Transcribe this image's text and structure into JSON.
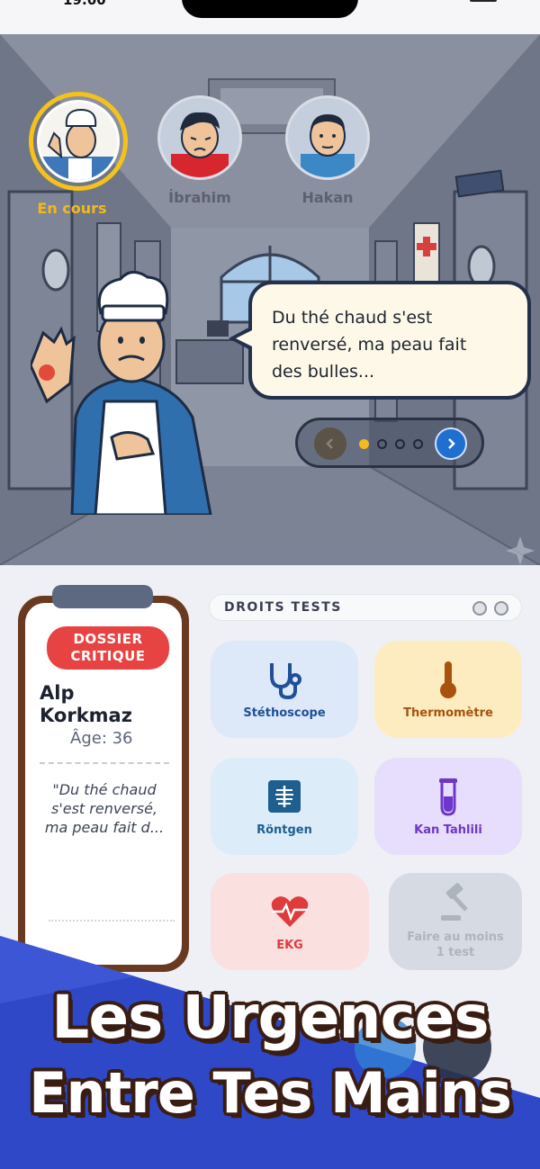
{
  "status": {
    "time": "19:00"
  },
  "patients": [
    {
      "label": "En cours",
      "active": true,
      "icon": "chef-patient-avatar"
    },
    {
      "label": "İbrahim",
      "active": false,
      "icon": "crying-boy-avatar"
    },
    {
      "label": "Hakan",
      "active": false,
      "icon": "boy-hoodie-avatar"
    }
  ],
  "dialogue": {
    "line1": "Du thé chaud s'est",
    "line2": "renversé, ma peau fait",
    "line3": "des bulles...",
    "pages_total": 4,
    "page_current": 1
  },
  "dossier": {
    "badge_line1": "DOSSIER",
    "badge_line2": "CRITIQUE",
    "first_name": "Alp",
    "last_name": "Korkmaz",
    "age": "Âge: 36",
    "quote_l1": "\"Du thé chaud",
    "quote_l2": "s'est renversé,",
    "quote_l3": "ma peau fait d..."
  },
  "tests": {
    "header": "DROITS TESTS",
    "items": [
      {
        "label": "Stéthoscope",
        "icon": "stethoscope-icon",
        "bg": "#dde8f8",
        "color": "#1f4f98"
      },
      {
        "label": "Thermomètre",
        "icon": "thermometer-icon",
        "bg": "#fdecc0",
        "color": "#a8520d"
      },
      {
        "label": "Röntgen",
        "icon": "xray-icon",
        "bg": "#dcecf8",
        "color": "#1f5f8f"
      },
      {
        "label": "Kan Tahlili",
        "icon": "blood-tube-icon",
        "bg": "#e7ddfc",
        "color": "#6d37c9"
      },
      {
        "label": "EKG",
        "icon": "heart-pulse-icon",
        "bg": "#fbe0e0",
        "color": "#e03b3b"
      },
      {
        "label_l1": "Faire au moins",
        "label_l2": "1 test",
        "icon": "gavel-icon",
        "bg": "#d6dbe3",
        "color": "#aeb4bd"
      }
    ]
  },
  "promo": {
    "line1": "Les Urgences",
    "line2": "Entre Tes Mains"
  }
}
